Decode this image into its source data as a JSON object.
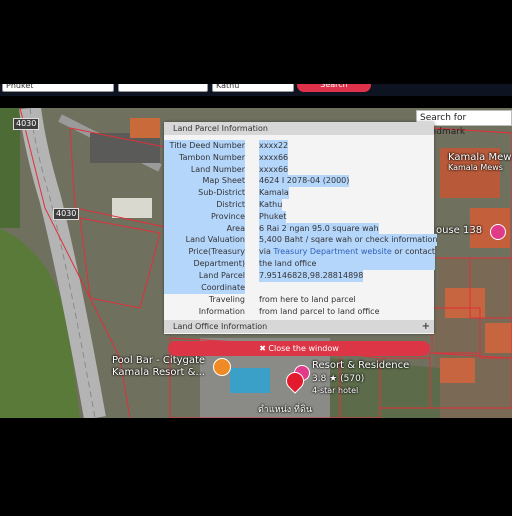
{
  "toolbar": {
    "select1": "Phuket",
    "select2": "",
    "select3": "Kathu",
    "search_button": "Search"
  },
  "map": {
    "search_landmark_placeholder": "Search for Landmark",
    "road_badge_1": "4030",
    "road_badge_2": "4030",
    "poi_kamala_mews": "Kamala Mew",
    "poi_kamala_mews_sub": "Kamala Mews",
    "poi_house": "ouse 138",
    "poi_pool_bar_1": "Pool Bar - Citygate",
    "poi_pool_bar_2": "Kamala Resort &...",
    "poi_resort_1": "Resort & Residence",
    "poi_rating": "3.8 ★ (570)",
    "poi_hotel_class": "4-star hotel",
    "poi_thai": "ตำแหน่ง ที่ดิน"
  },
  "popup": {
    "section1_title": "Land Parcel Information",
    "rows": [
      {
        "label": "Title Deed Number",
        "value": "xxxx22"
      },
      {
        "label": "Tambon Number",
        "value": "xxxx66"
      },
      {
        "label": "Land Number",
        "value": "xxxx66"
      },
      {
        "label": "Map Sheet",
        "value": "4624 I 2078-04 (2000)"
      },
      {
        "label": "Sub-District",
        "value": "Kamala"
      },
      {
        "label": "District",
        "value": "Kathu"
      },
      {
        "label": "Province",
        "value": "Phuket"
      },
      {
        "label": "Area",
        "value": "6 Rai 2 ngan 95.0 square wah"
      },
      {
        "label": "Land Valuation",
        "value": "5,400 Baht / sqare wah or check information"
      }
    ],
    "price_label_1": "Price(Treasury",
    "price_label_2": "Department)",
    "price_value_prefix": "via ",
    "price_value_link": "Treasury Department website",
    "price_value_suffix": " or contact",
    "price_value_line2": "the land office",
    "coord_label_1": "Land Parcel",
    "coord_label_2": "Coordinate",
    "coord_value": "7.95146828,98.28814898",
    "travel_label": "Traveling Information",
    "travel_link_1": "from here to land parcel",
    "travel_link_2": "from land parcel to land office",
    "section2_title": "Land Office Information",
    "section2_toggle": "+",
    "close_button": "✖ Close the window"
  },
  "colors": {
    "accent_red": "#dc3545",
    "highlight_blue": "#b5d6fb",
    "link_blue": "#2f62b8",
    "parcel_outline": "#e0303a"
  }
}
